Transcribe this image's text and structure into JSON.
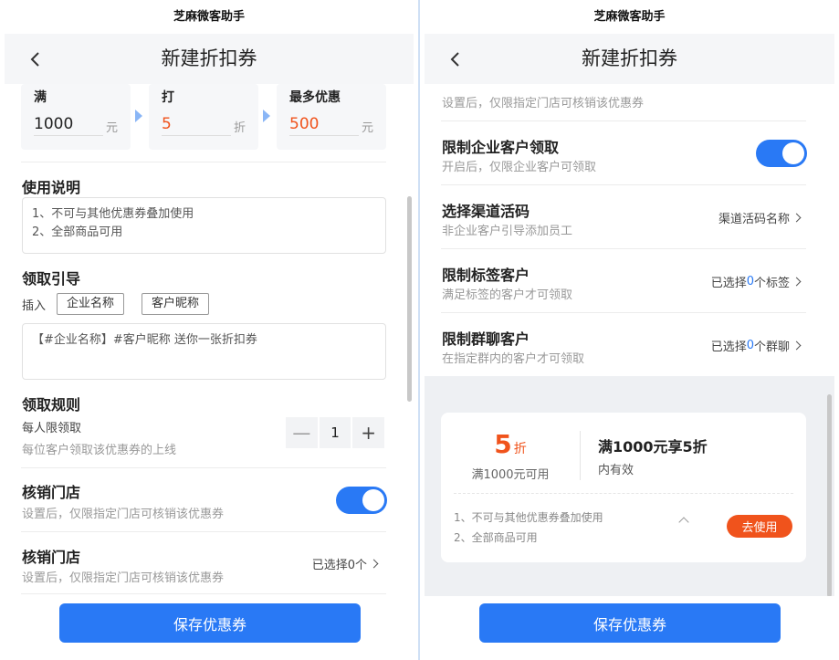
{
  "app_title": "芝麻微客助手",
  "page_title": "新建折扣券",
  "save_label": "保存优惠券",
  "colors": {
    "accent": "#2979f5",
    "highlight": "#f0531c"
  },
  "icons": {
    "back": "chevron-left-icon",
    "chevron": "chevron-right-icon",
    "arrow": "triangle-right-icon"
  },
  "left": {
    "discount": {
      "full": {
        "label": "满",
        "value": "1000",
        "unit": "元"
      },
      "rate": {
        "label": "打",
        "value": "5",
        "unit": "折"
      },
      "max": {
        "label": "最多优惠",
        "value": "500",
        "unit": "元"
      }
    },
    "usage": {
      "title": "使用说明",
      "lines": [
        "1、不可与其他优惠券叠加使用",
        "2、全部商品可用"
      ]
    },
    "guide": {
      "title": "领取引导",
      "insert_label": "插入",
      "tags": [
        "企业名称",
        "客户昵称"
      ],
      "text": "【#企业名称】#客户昵称 送你一张折扣券"
    },
    "rule": {
      "title": "领取规则",
      "per_label": "每人限领取",
      "per_hint": "每位客户领取该优惠券的上线",
      "limit": "1",
      "minus": "—",
      "plus": "+"
    },
    "store_toggle": {
      "title": "核销门店",
      "sub": "设置后，仅限指定门店可核销该优惠券"
    },
    "store_select": {
      "title": "核销门店",
      "sub": "设置后，仅限指定门店可核销该优惠券",
      "right": "已选择0个"
    }
  },
  "right": {
    "top_hint": "设置后，仅限指定门店可核销该优惠券",
    "rows": [
      {
        "title": "限制企业客户领取",
        "sub": "开启后，仅限企业客户可领取"
      },
      {
        "title": "选择渠道活码",
        "sub": "非企业客户引导添加员工",
        "right": "渠道活码名称"
      },
      {
        "title": "限制标签客户",
        "sub": "满足标签的客户才可领取",
        "right_prefix": "已选择",
        "right_num": "0",
        "right_suffix": "个标签"
      },
      {
        "title": "限制群聊客户",
        "sub": "在指定群内的客户才可领取",
        "right_prefix": "已选择",
        "right_num": "0",
        "right_suffix": "个群聊"
      }
    ],
    "coupon": {
      "value": "5",
      "unit": "折",
      "condition": "满1000元可用",
      "title": "满1000元享5折",
      "validity": "内有效",
      "desc": [
        "1、不可与其他优惠券叠加使用",
        "2、全部商品可用"
      ],
      "use_label": "去使用"
    }
  }
}
